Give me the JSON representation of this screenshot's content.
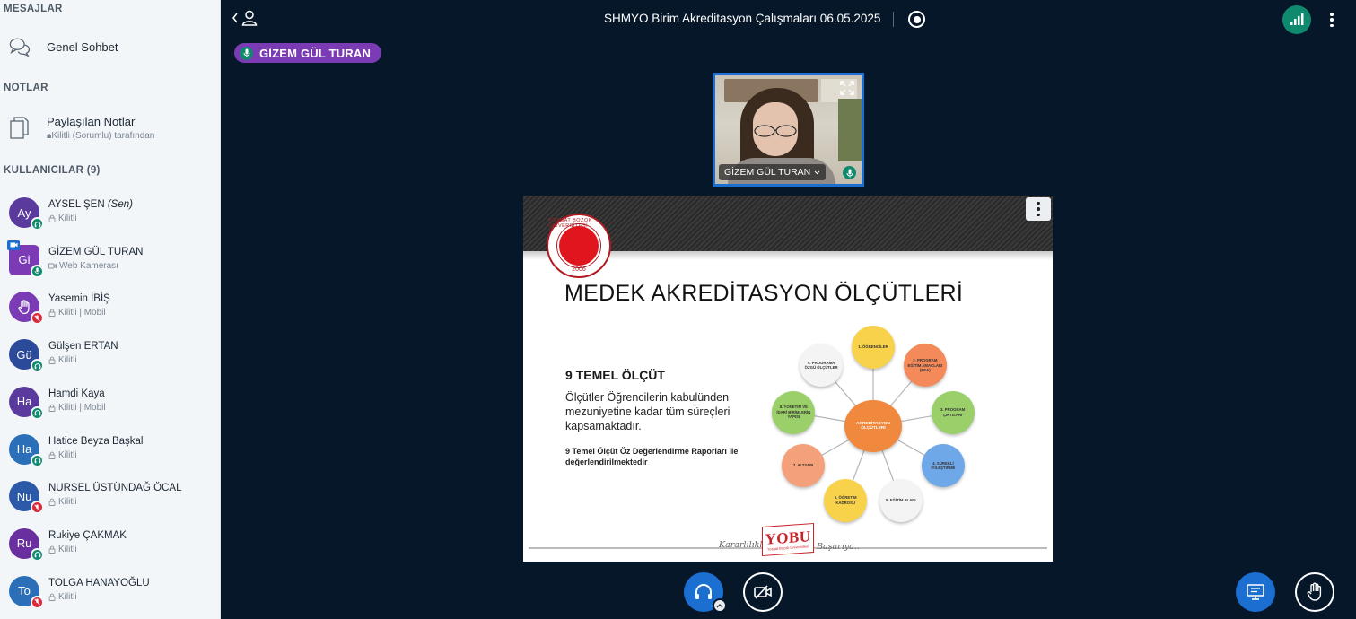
{
  "sidebar": {
    "messages_title": "MESAJLAR",
    "public_chat": "Genel Sohbet",
    "notes_title": "NOTLAR",
    "shared_notes": "Paylaşılan Notlar",
    "shared_notes_sub": "Kilitli (Sorumlu) tarafından",
    "users_title": "KULLANICILAR (9)",
    "users": [
      {
        "initials": "Ay",
        "name": "AYSEL ŞEN",
        "you": "(Sen)",
        "sub": "Kilitli",
        "color": "#5b3a9e",
        "status": "green",
        "status_icon": "headset-icon"
      },
      {
        "initials": "Gi",
        "name": "GİZEM GÜL TURAN",
        "sub": "Web Kamerası",
        "color": "#7a3bb5",
        "status": "green",
        "status_icon": "microphone-icon",
        "webcam": true
      },
      {
        "initials": "",
        "name": "Yasemin İBİŞ",
        "sub": "Kilitli | Mobil",
        "color": "#7a3bb5",
        "status": "red",
        "status_icon": "muted-microphone-icon",
        "raised_hand": true
      },
      {
        "initials": "Gü",
        "name": "Gülşen ERTAN",
        "sub": "Kilitli",
        "color": "#2c4a9a",
        "status": "green",
        "status_icon": "headset-icon"
      },
      {
        "initials": "Ha",
        "name": "Hamdi Kaya",
        "sub": "Kilitli | Mobil",
        "color": "#5b3a9e",
        "status": "green",
        "status_icon": "headset-icon"
      },
      {
        "initials": "Ha",
        "name": "Hatice Beyza Başkal",
        "sub": "Kilitli",
        "color": "#2a6fb8",
        "status": "green",
        "status_icon": "headset-icon"
      },
      {
        "initials": "Nu",
        "name": "NURSEL ÜSTÜNDAĞ ÖCAL",
        "sub": "Kilitli",
        "color": "#2c5aa8",
        "status": "red",
        "status_icon": "muted-microphone-icon"
      },
      {
        "initials": "Ru",
        "name": "Rukiye ÇAKMAK",
        "sub": "Kilitli",
        "color": "#6a2f9e",
        "status": "green",
        "status_icon": "headset-icon"
      },
      {
        "initials": "To",
        "name": "TOLGA HANAYOĞLU",
        "sub": "Kilitli",
        "color": "#2a6fb8",
        "status": "red",
        "status_icon": "muted-microphone-icon"
      }
    ]
  },
  "topbar": {
    "title": "SHMYO Birim Akreditasyon Çalışmaları 06.05.2025"
  },
  "talking_indicator": "GİZEM GÜL TURAN",
  "webcam": {
    "name": "GİZEM GÜL TURAN"
  },
  "slide": {
    "title": "MEDEK AKREDİTASYON ÖLÇÜTLERİ",
    "heading": "9 TEMEL ÖLÇÜT",
    "body": "Ölçütler Öğrencilerin kabulünden mezuniyetine kadar tüm süreçleri kapsamaktadır.",
    "note": "9 Temel Ölçüt Öz Değerlendirme Raporları ile değerlendirilmektedir",
    "seal_text": "YOZGAT BOZOK ÜNİVERSİTESİ",
    "seal_year": "2006",
    "logo": "YOBU",
    "footer_left": "Kararlılıkla",
    "footer_right": "Başarıya..",
    "center_node": "AKREDİTASYON ÖLÇÜTLERİ",
    "nodes": [
      {
        "label": "1. ÖĞRENCİLER",
        "color": "#f7d24a"
      },
      {
        "label": "2. PROGRAM EĞİTİM AMAÇLARI (PEA)",
        "color": "#f48a5a"
      },
      {
        "label": "3. PROGRAM ÇIKTILARI",
        "color": "#9bcf6a"
      },
      {
        "label": "4. SÜREKLİ İYİLEŞTİRME",
        "color": "#6fa8e8"
      },
      {
        "label": "5. EĞİTİM PLANI",
        "color": "#f4f4f4"
      },
      {
        "label": "6. ÖĞRETİM KADROSU",
        "color": "#f7d24a"
      },
      {
        "label": "7. ALTYAPI",
        "color": "#f4a07a"
      },
      {
        "label": "8. YÖNETİM VE İDARİ BİRİMLERİN YAPISI",
        "color": "#9bcf6a"
      },
      {
        "label": "9. PROGRAMA ÖZGÜ ÖLÇÜTLER",
        "color": "#f4f4f4"
      }
    ]
  }
}
